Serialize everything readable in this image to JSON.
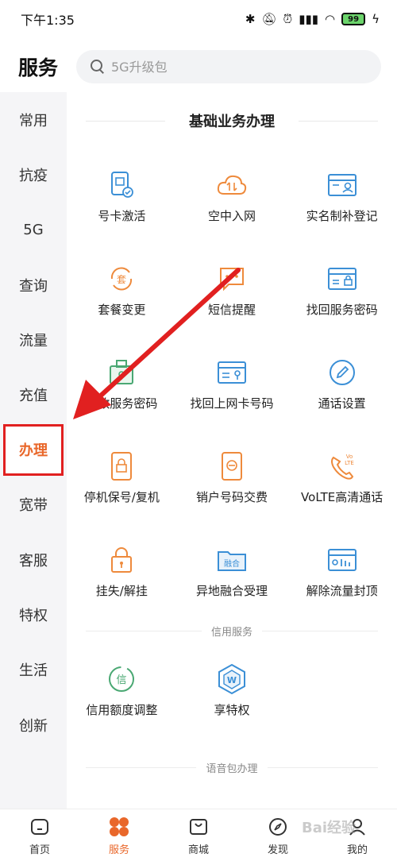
{
  "status_bar": {
    "time": "下午1:35",
    "battery": "99"
  },
  "header": {
    "title": "服务",
    "search_placeholder": "5G升级包"
  },
  "sidebar": {
    "items": [
      {
        "label": "常用"
      },
      {
        "label": "抗疫"
      },
      {
        "label": "5G"
      },
      {
        "label": "查询"
      },
      {
        "label": "流量"
      },
      {
        "label": "充值"
      },
      {
        "label": "办理"
      },
      {
        "label": "宽带"
      },
      {
        "label": "客服"
      },
      {
        "label": "特权"
      },
      {
        "label": "生活"
      },
      {
        "label": "创新"
      }
    ],
    "active": "办理"
  },
  "main": {
    "section_basic": {
      "title": "基础业务办理",
      "items": [
        {
          "label": "号卡激活",
          "icon": "sim-card-icon"
        },
        {
          "label": "空中入网",
          "icon": "cloud-icon"
        },
        {
          "label": "实名制补登记",
          "icon": "id-card-icon"
        },
        {
          "label": "套餐变更",
          "icon": "package-change-icon"
        },
        {
          "label": "短信提醒",
          "icon": "sms-icon"
        },
        {
          "label": "找回服务密码",
          "icon": "password-lock-icon"
        },
        {
          "label": "修改服务密码",
          "icon": "modify-password-icon"
        },
        {
          "label": "找回上网卡号码",
          "icon": "card-key-icon"
        },
        {
          "label": "通话设置",
          "icon": "pencil-icon"
        },
        {
          "label": "停机保号/复机",
          "icon": "phone-lock-icon"
        },
        {
          "label": "销户号码交费",
          "icon": "phone-minus-icon"
        },
        {
          "label": "VoLTE高清通话",
          "icon": "volte-phone-icon"
        },
        {
          "label": "挂失/解挂",
          "icon": "padlock-icon"
        },
        {
          "label": "异地融合受理",
          "icon": "merge-folder-icon"
        },
        {
          "label": "解除流量封顶",
          "icon": "data-chart-icon"
        }
      ]
    },
    "section_credit": {
      "title": "信用服务",
      "items": [
        {
          "label": "信用额度调整",
          "icon": "credit-icon"
        },
        {
          "label": "享特权",
          "icon": "privilege-hex-icon"
        }
      ]
    },
    "section_voice": {
      "title": "语音包办理"
    }
  },
  "tabbar": {
    "items": [
      {
        "label": "首页",
        "icon": "home-icon"
      },
      {
        "label": "服务",
        "icon": "service-clover-icon"
      },
      {
        "label": "商城",
        "icon": "shopping-bag-icon"
      },
      {
        "label": "发现",
        "icon": "compass-icon"
      },
      {
        "label": "我的",
        "icon": "user-icon"
      }
    ],
    "active": "服务"
  },
  "colors": {
    "accent": "#e9672a",
    "annotation": "#e12020",
    "icon_blue": "#3b8fd6",
    "icon_orange": "#ee8a3c"
  },
  "watermark": "Bai经验"
}
